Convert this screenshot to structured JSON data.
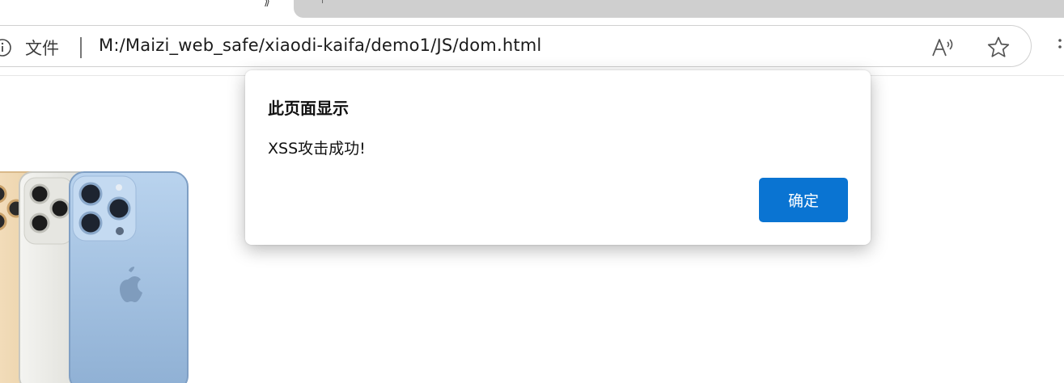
{
  "tab": {
    "glyph_left": "⟫",
    "glyph_right": "⊢"
  },
  "omnibox": {
    "scheme_label": "文件",
    "url": "M:/Maizi_web_safe/xiaodi-kaifa/demo1/JS/dom.html"
  },
  "toolbar": {
    "read_aloud_icon": "read-aloud-icon",
    "favorite_icon": "star-icon",
    "more_icon": "more-icon"
  },
  "dialog": {
    "title": "此页面显示",
    "message": "XSS攻击成功!",
    "ok_label": "确定",
    "ok_color": "#0a74d2"
  },
  "colors": {
    "tab_inactive": "#cfcfcf",
    "phone_blue": "#a7c4e2",
    "phone_silver": "#eef0ec",
    "phone_gold": "#f3dcb8"
  }
}
